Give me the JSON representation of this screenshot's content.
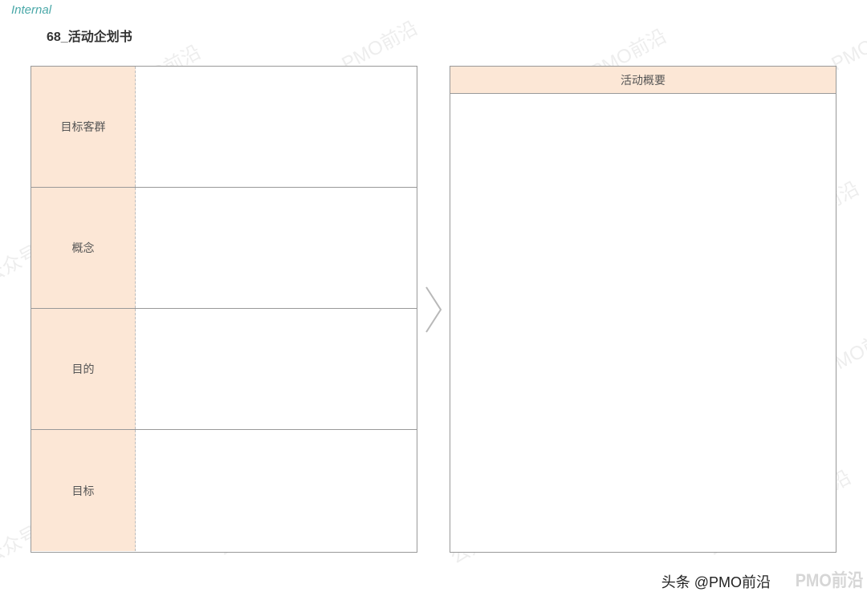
{
  "header": {
    "internal_label": "Internal",
    "page_title": "68_活动企划书"
  },
  "left_panel": {
    "rows": [
      {
        "label": "目标客群"
      },
      {
        "label": "概念"
      },
      {
        "label": "目的"
      },
      {
        "label": "目标"
      }
    ]
  },
  "right_panel": {
    "header": "活动概要"
  },
  "watermark_text": "公众号：PMO前沿",
  "attribution": "头条 @PMO前沿",
  "brand": "PMO前沿"
}
